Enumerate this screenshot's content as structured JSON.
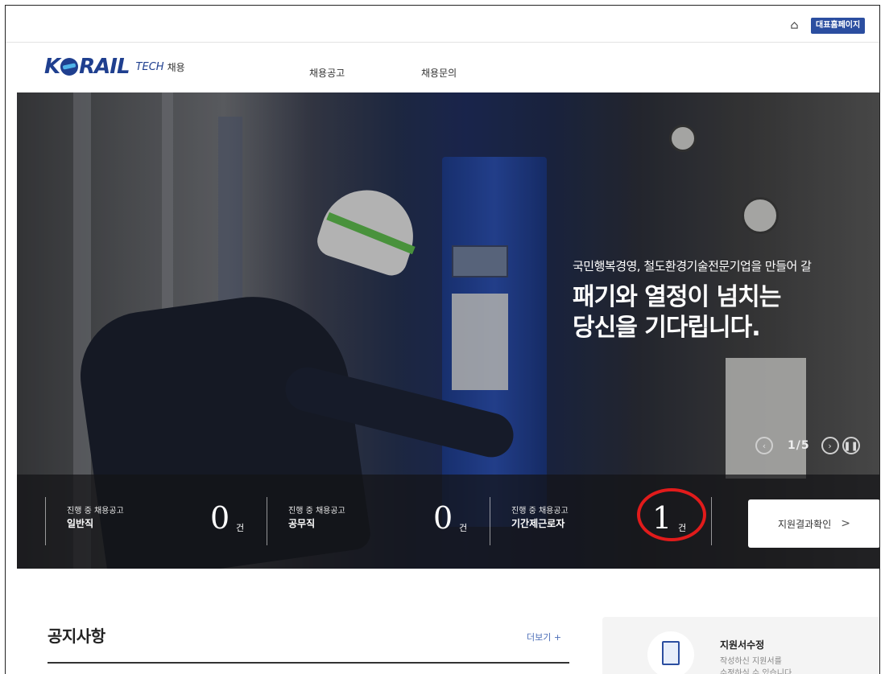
{
  "utility": {
    "home_icon": "home-icon",
    "main_site_label": "대표홈페이지"
  },
  "header": {
    "logo_text": "KORAIL",
    "logo_sub": "TECH",
    "logo_sub2": "채용",
    "nav": [
      "채용공고",
      "채용문의"
    ]
  },
  "hero": {
    "lead": "국민행복경영, 철도환경기술전문기업을 만들어 갈",
    "headline_line1": "패기와 열정이 넘치는",
    "headline_line2": "당신을 기다립니다.",
    "slide_counter": "1/5"
  },
  "stats": [
    {
      "caption": "진행 중 채용공고",
      "kind": "일반직",
      "count": "0",
      "unit": "건"
    },
    {
      "caption": "진행 중 채용공고",
      "kind": "공무직",
      "count": "0",
      "unit": "건"
    },
    {
      "caption": "진행 중 채용공고",
      "kind": "기간제근로자",
      "count": "1",
      "unit": "건"
    }
  ],
  "result_button": {
    "label": "지원결과확인",
    "chevron": ">"
  },
  "notice": {
    "title": "공지사항",
    "more": "더보기 +"
  },
  "edit_card": {
    "title": "지원서수정",
    "desc_line1": "작성하신 지원서를",
    "desc_line2": "수정하실 수 있습니다"
  },
  "colors": {
    "brand": "#1f3f8f",
    "button": "#2b4ea0",
    "highlight": "#e11b1b"
  }
}
